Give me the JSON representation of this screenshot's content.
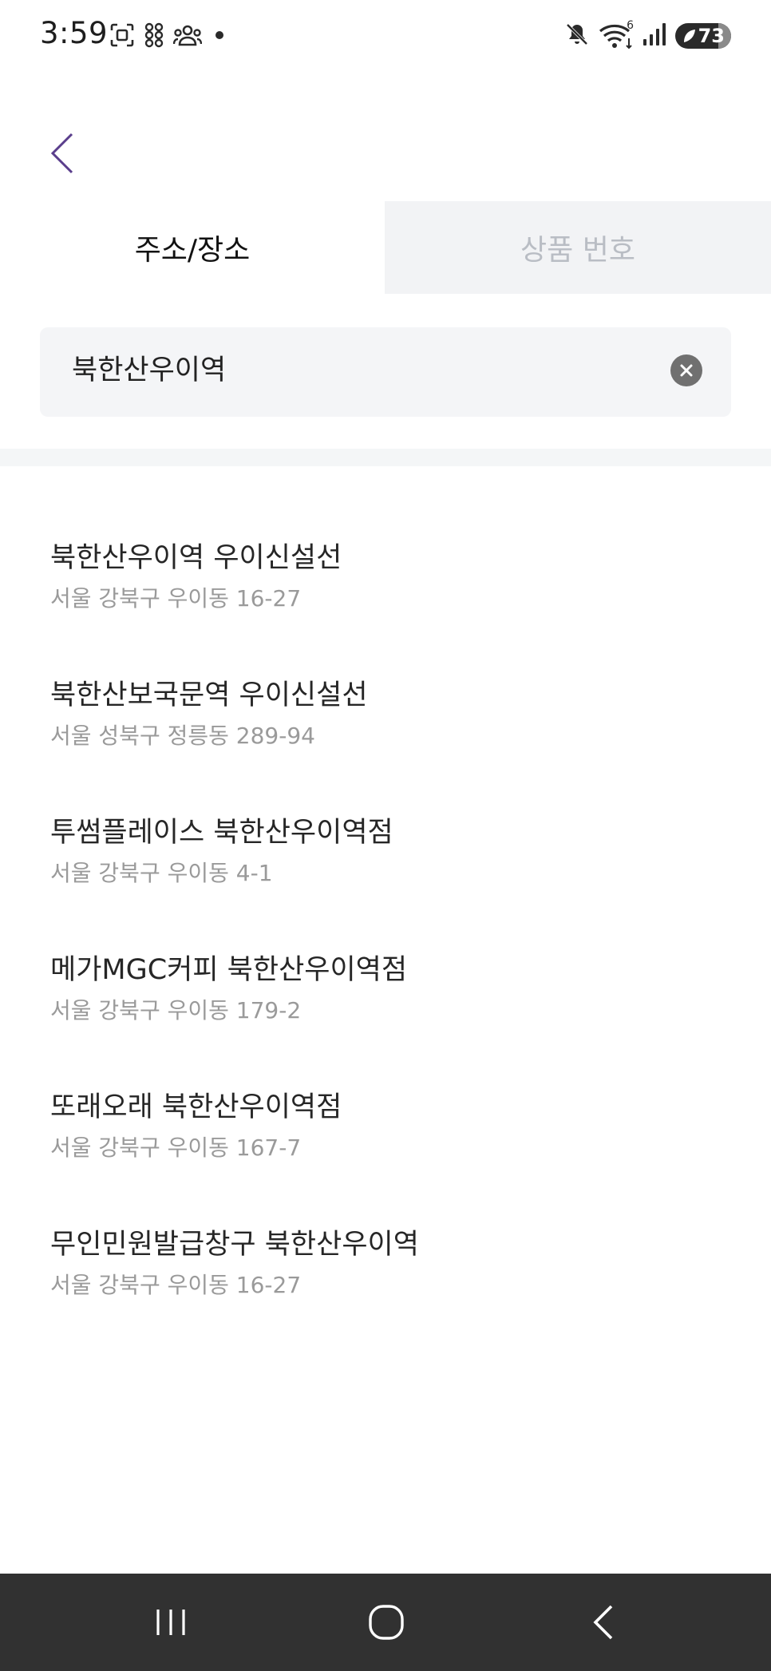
{
  "status_bar": {
    "time": "3:59",
    "battery": "73",
    "left_icons": [
      "screenshot-icon",
      "app-grid-icon",
      "people-icon",
      "dot-icon"
    ],
    "right_icons": [
      "mute-icon",
      "wifi-icon",
      "signal-icon",
      "battery-icon"
    ],
    "wifi_label": "6"
  },
  "header": {
    "back_icon": "chevron-left-icon"
  },
  "tabs": [
    {
      "label": "주소/장소",
      "active": true
    },
    {
      "label": "상품 번호",
      "active": false
    }
  ],
  "search": {
    "value": "북한산우이역",
    "clear_icon": "clear-circle-icon"
  },
  "results": [
    {
      "title": "북한산우이역 우이신설선",
      "address": "서울 강북구 우이동 16-27"
    },
    {
      "title": "북한산보국문역 우이신설선",
      "address": "서울 성북구 정릉동 289-94"
    },
    {
      "title": "투썸플레이스 북한산우이역점",
      "address": "서울 강북구 우이동 4-1"
    },
    {
      "title": "메가MGC커피 북한산우이역점",
      "address": "서울 강북구 우이동 179-2"
    },
    {
      "title": "또래오래 북한산우이역점",
      "address": "서울 강북구 우이동 167-7"
    },
    {
      "title": "무인민원발급창구 북한산우이역",
      "address": "서울 강북구 우이동 16-27"
    }
  ],
  "nav_bar": {
    "icons": [
      "recent-apps-icon",
      "home-icon",
      "back-icon"
    ]
  },
  "colors": {
    "accent": "#5a3e8c",
    "tab_inactive_bg": "#f2f3f5",
    "tab_inactive_text": "#b9bdc4",
    "address_text": "#9a9a9a",
    "nav_bar_bg": "#313131"
  }
}
